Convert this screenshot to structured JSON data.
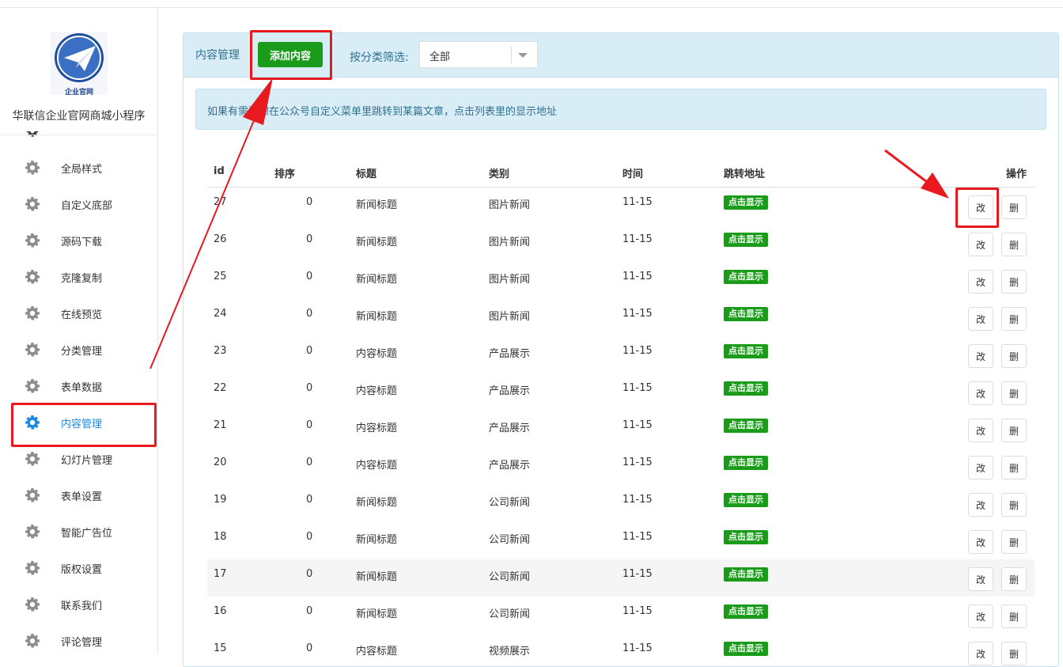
{
  "sidebar": {
    "logo_text": "企业官网",
    "app_name": "华联信企业官网商城小程序",
    "items": [
      {
        "label": "全局样式"
      },
      {
        "label": "自定义底部"
      },
      {
        "label": "源码下载"
      },
      {
        "label": "克隆复制"
      },
      {
        "label": "在线预览"
      },
      {
        "label": "分类管理"
      },
      {
        "label": "表单数据"
      },
      {
        "label": "内容管理",
        "active": true
      },
      {
        "label": "幻灯片管理"
      },
      {
        "label": "表单设置"
      },
      {
        "label": "智能广告位"
      },
      {
        "label": "版权设置"
      },
      {
        "label": "联系我们"
      },
      {
        "label": "评论管理"
      }
    ]
  },
  "header": {
    "title": "内容管理",
    "add_button": "添加内容",
    "filter_label": "按分类筛选:",
    "filter_value": "全部"
  },
  "notice": "如果有需要想在公众号自定义菜单里跳转到某篇文章，点击列表里的显示地址",
  "table": {
    "columns": [
      "id",
      "排序",
      "标题",
      "类别",
      "时间",
      "跳转地址",
      "操作"
    ],
    "link_label": "点击显示",
    "edit_label": "改",
    "delete_label": "删",
    "rows": [
      {
        "id": "27",
        "sort": "0",
        "title": "新闻标题",
        "category": "图片新闻",
        "time": "11-15"
      },
      {
        "id": "26",
        "sort": "0",
        "title": "新闻标题",
        "category": "图片新闻",
        "time": "11-15"
      },
      {
        "id": "25",
        "sort": "0",
        "title": "新闻标题",
        "category": "图片新闻",
        "time": "11-15"
      },
      {
        "id": "24",
        "sort": "0",
        "title": "新闻标题",
        "category": "图片新闻",
        "time": "11-15"
      },
      {
        "id": "23",
        "sort": "0",
        "title": "内容标题",
        "category": "产品展示",
        "time": "11-15"
      },
      {
        "id": "22",
        "sort": "0",
        "title": "内容标题",
        "category": "产品展示",
        "time": "11-15"
      },
      {
        "id": "21",
        "sort": "0",
        "title": "内容标题",
        "category": "产品展示",
        "time": "11-15"
      },
      {
        "id": "20",
        "sort": "0",
        "title": "内容标题",
        "category": "产品展示",
        "time": "11-15"
      },
      {
        "id": "19",
        "sort": "0",
        "title": "新闻标题",
        "category": "公司新闻",
        "time": "11-15"
      },
      {
        "id": "18",
        "sort": "0",
        "title": "新闻标题",
        "category": "公司新闻",
        "time": "11-15"
      },
      {
        "id": "17",
        "sort": "0",
        "title": "新闻标题",
        "category": "公司新闻",
        "time": "11-15",
        "highlight": true
      },
      {
        "id": "16",
        "sort": "0",
        "title": "新闻标题",
        "category": "公司新闻",
        "time": "11-15"
      },
      {
        "id": "15",
        "sort": "0",
        "title": "内容标题",
        "category": "视频展示",
        "time": "11-15"
      }
    ]
  },
  "colors": {
    "accent_green": "#1a9c1a",
    "info_bg": "#d9edf7",
    "info_text": "#31708f",
    "active_blue": "#1e88e5",
    "annotation_red": "#e8191f"
  }
}
